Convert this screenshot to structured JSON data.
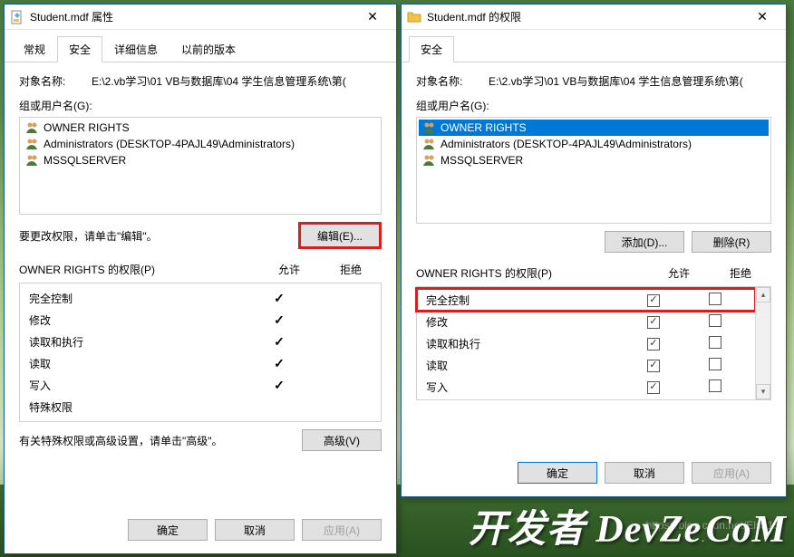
{
  "left": {
    "title": "Student.mdf 属性",
    "tabs": {
      "general": "常规",
      "security": "安全",
      "details": "详细信息",
      "previous": "以前的版本"
    },
    "objectNameLabel": "对象名称:",
    "objectNameValue": "E:\\2.vb学习\\01 VB与数据库\\04 学生信息管理系统\\第(",
    "groupsLabel": "组或用户名(G):",
    "groups": [
      {
        "name": "OWNER RIGHTS"
      },
      {
        "name": "Administrators (DESKTOP-4PAJL49\\Administrators)"
      },
      {
        "name": "MSSQLSERVER"
      }
    ],
    "editHint": "要更改权限，请单击\"编辑\"。",
    "editBtn": "编辑(E)...",
    "permHeaderName": "OWNER RIGHTS 的权限(P)",
    "permAllow": "允许",
    "permDeny": "拒绝",
    "perms": [
      {
        "name": "完全控制",
        "allow": true
      },
      {
        "name": "修改",
        "allow": true
      },
      {
        "name": "读取和执行",
        "allow": true
      },
      {
        "name": "读取",
        "allow": true
      },
      {
        "name": "写入",
        "allow": true
      },
      {
        "name": "特殊权限",
        "allow": false
      }
    ],
    "advHint": "有关特殊权限或高级设置，请单击\"高级\"。",
    "advBtn": "高级(V)",
    "okBtn": "确定",
    "cancelBtn": "取消",
    "applyBtn": "应用(A)"
  },
  "right": {
    "title": "Student.mdf 的权限",
    "tabSecurity": "安全",
    "objectNameLabel": "对象名称:",
    "objectNameValue": "E:\\2.vb学习\\01 VB与数据库\\04 学生信息管理系统\\第(",
    "groupsLabel": "组或用户名(G):",
    "groups": [
      {
        "name": "OWNER RIGHTS",
        "selected": true
      },
      {
        "name": "Administrators (DESKTOP-4PAJL49\\Administrators)"
      },
      {
        "name": "MSSQLSERVER"
      }
    ],
    "addBtn": "添加(D)...",
    "removeBtn": "删除(R)",
    "permHeaderName": "OWNER RIGHTS 的权限(P)",
    "permAllow": "允许",
    "permDeny": "拒绝",
    "perms": [
      {
        "name": "完全控制",
        "allow": true,
        "deny": false,
        "highlight": true
      },
      {
        "name": "修改",
        "allow": true,
        "deny": false
      },
      {
        "name": "读取和执行",
        "allow": true,
        "deny": false
      },
      {
        "name": "读取",
        "allow": true,
        "deny": false
      },
      {
        "name": "写入",
        "allow": true,
        "deny": false
      }
    ],
    "okBtn": "确定",
    "cancelBtn": "取消",
    "applyBtn": "应用(A)"
  },
  "watermark": "DevZe.CoM",
  "faintUrl": "https://blog.csdn.net/Elsa15"
}
